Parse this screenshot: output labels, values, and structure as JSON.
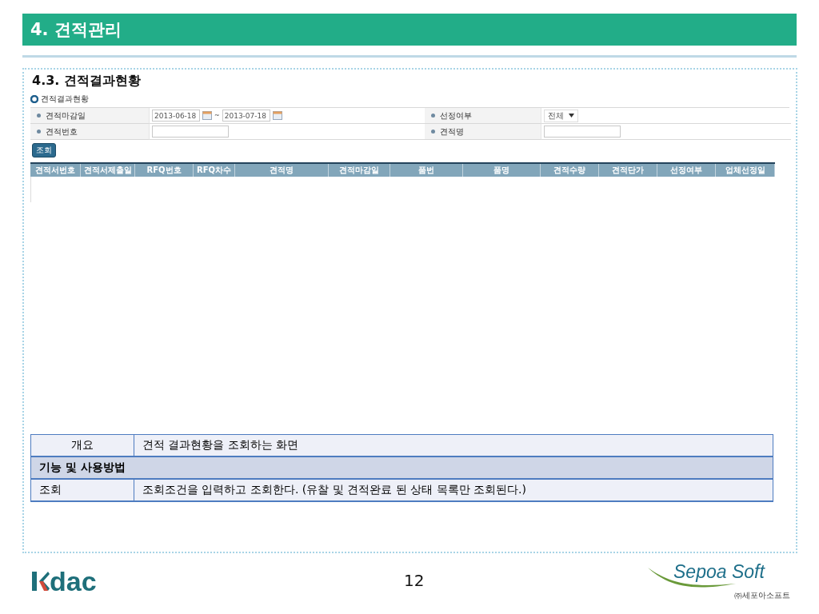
{
  "header": {
    "title": "4. 견적관리"
  },
  "section_title": "4.3. 견적결과현황",
  "screen": {
    "title": "견적결과현황",
    "search_fields": [
      {
        "label": "견적마감일",
        "kind": "daterange",
        "from": "2013-06-18",
        "separator": "~",
        "to": "2013-07-18"
      },
      {
        "label": "선정여부",
        "kind": "select",
        "value": "전체"
      },
      {
        "label": "견적번호",
        "kind": "text"
      },
      {
        "label": "견적명",
        "kind": "text"
      }
    ],
    "search_button": "조회",
    "grid": {
      "columns": [
        {
          "label": "견적서번호"
        },
        {
          "label": "견적서제출일"
        },
        {
          "label": "RFQ번호"
        },
        {
          "label": "RFQ차수"
        },
        {
          "label": "견적명"
        },
        {
          "label": "견적마감일"
        },
        {
          "label": "품번"
        },
        {
          "label": "품명"
        },
        {
          "label": "견적수량"
        },
        {
          "label": "견적단가"
        },
        {
          "label": "선정여부"
        },
        {
          "label": "업체선정일"
        }
      ]
    }
  },
  "description": [
    {
      "kind": "row",
      "label": "개요",
      "text": "견적 결과현황을 조회하는 화면"
    },
    {
      "kind": "heading",
      "text": "기능 및 사용방법"
    },
    {
      "kind": "row",
      "label": "조회",
      "text": "조회조건을 입력하고 조회한다. (유찰 및 견적완료 된 상태 목록만 조회된다.)"
    }
  ],
  "footer": {
    "left_logo": "dac",
    "page_number": "12",
    "right_logo": "Sepoa Soft",
    "right_logo_sub": "㈜세포아소프트"
  }
}
